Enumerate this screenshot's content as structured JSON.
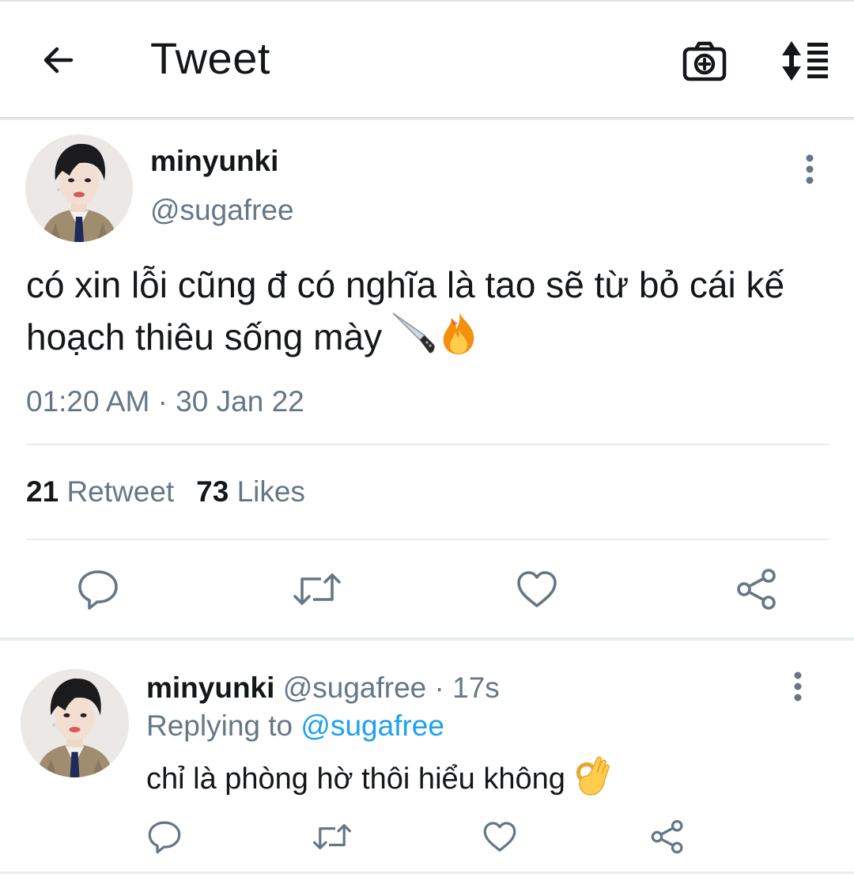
{
  "header": {
    "title": "Tweet",
    "back_icon": "arrow-left-icon",
    "camera_icon": "camera-plus-icon",
    "sort_icon": "sort-list-icon"
  },
  "main_tweet": {
    "author_name": "minyunki",
    "author_handle": "@sugafree",
    "text": "có xin lỗi cũng đ có nghĩa là tao sẽ từ bỏ cái kế hoạch thiêu sống mày",
    "emojis": [
      "knife-emoji",
      "fire-emoji"
    ],
    "timestamp": "01:20 AM · 30 Jan 22",
    "retweet_count": "21",
    "retweet_label": "Retweet",
    "like_count": "73",
    "like_label": "Likes",
    "actions": [
      "reply-icon",
      "retweet-icon",
      "heart-icon",
      "share-icon"
    ]
  },
  "reply": {
    "author_name": "minyunki",
    "author_handle": "@sugafree",
    "separator": " · ",
    "time_ago": "17s",
    "replying_prefix": "Replying to",
    "replying_to": "@sugafree",
    "text": "chỉ là phòng hờ thôi hiểu không",
    "emoji": "ok-hand-emoji",
    "actions": [
      "reply-icon",
      "retweet-icon",
      "heart-icon",
      "share-icon"
    ]
  },
  "colors": {
    "text_primary": "#14171a",
    "text_secondary": "#657786",
    "accent": "#1da1f2",
    "divider": "#e6ecf0"
  }
}
